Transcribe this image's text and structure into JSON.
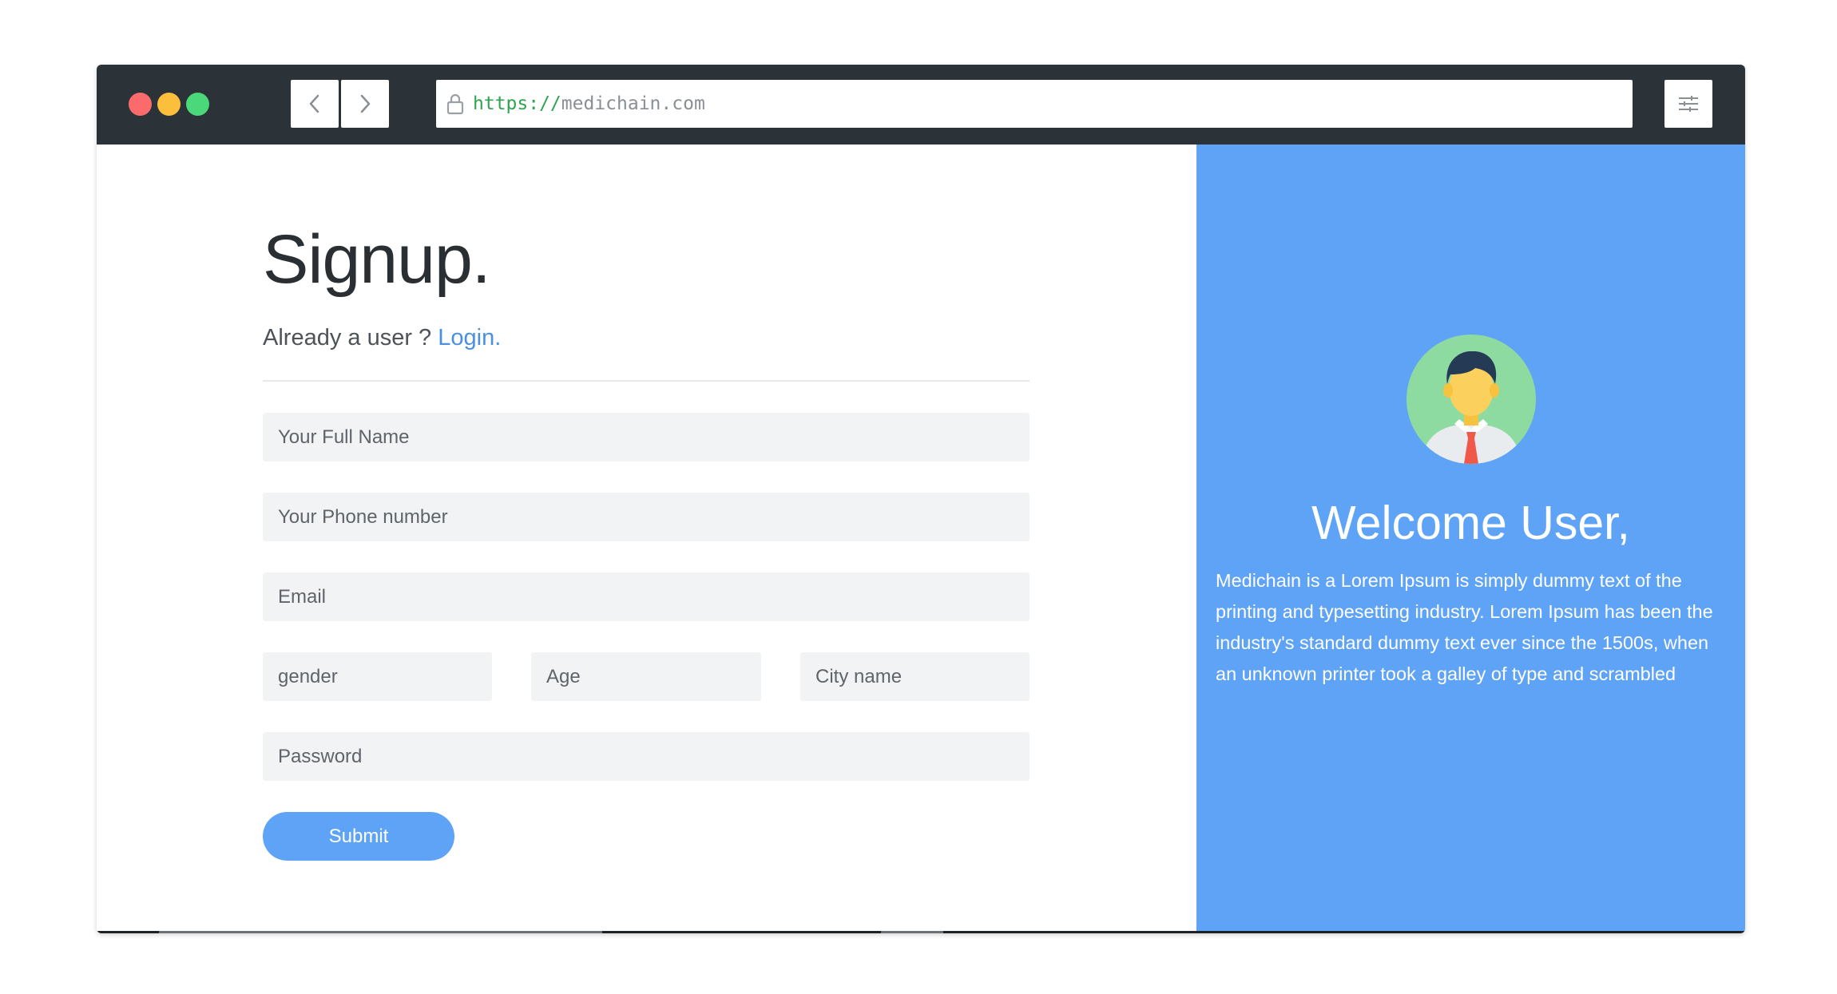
{
  "browser": {
    "url_scheme": "https://",
    "url_host": "medichain.com",
    "back_icon": "chevron-left-icon",
    "forward_icon": "chevron-right-icon",
    "lock_icon": "lock-icon",
    "settings_icon": "sliders-icon",
    "traffic_lights": [
      "#fc6b6b",
      "#fbbf3c",
      "#4bd87b"
    ]
  },
  "signup": {
    "title": "Signup.",
    "already_text": "Already a user ? ",
    "login_link": "Login.",
    "fields": {
      "full_name": "Your Full Name",
      "phone": "Your Phone number",
      "email": "Email",
      "gender": "gender",
      "age": "Age",
      "city": "City name",
      "password": "Password"
    },
    "submit_label": "Submit"
  },
  "welcome_panel": {
    "avatar_icon": "user-avatar-icon",
    "heading": "Welcome User,",
    "description": "Medichain is a Lorem Ipsum is simply dummy text of the printing and typesetting industry. Lorem Ipsum has been the industry's standard dummy text ever since the 1500s, when an unknown printer took a galley of type and scrambled"
  },
  "colors": {
    "accent": "#5ea3f6",
    "titlebar": "#2c3338",
    "input_bg": "#f2f3f5",
    "link": "#4a90e2"
  }
}
